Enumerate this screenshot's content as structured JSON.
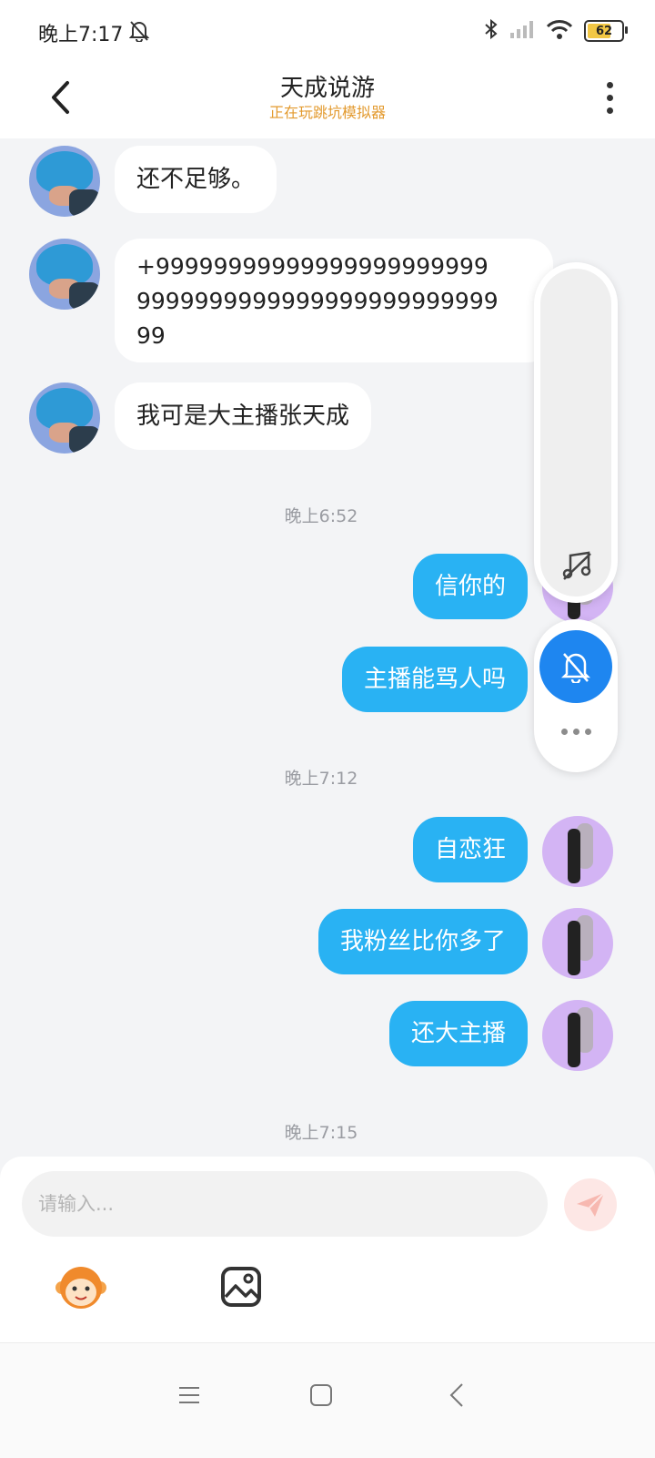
{
  "status_bar": {
    "time": "晚上7:17",
    "battery": "62",
    "icons": [
      "bell-off-icon",
      "bluetooth-icon",
      "signal-icon",
      "wifi-icon",
      "battery-icon"
    ]
  },
  "header": {
    "title": "天成说游",
    "subtitle": "正在玩跳坑模拟器"
  },
  "messages": {
    "m1": "还不足够。",
    "m2_line1": "+99999999999999999999999",
    "m2_line2": "9999999999999999999999999",
    "m2_line3": "99",
    "m3": "我可是大主播张天成",
    "time1": "晚上6:52",
    "m4": "信你的",
    "m5": "主播能骂人吗",
    "time2": "晚上7:12",
    "m6": "自恋狂",
    "m7": "我粉丝比你多了",
    "m8": "还大主播",
    "time3": "晚上7:15"
  },
  "input": {
    "placeholder": "请输入..."
  },
  "colors": {
    "accent": "#29b2f3",
    "subtitle": "#e39a2e",
    "mute_button": "#1e86f0"
  }
}
